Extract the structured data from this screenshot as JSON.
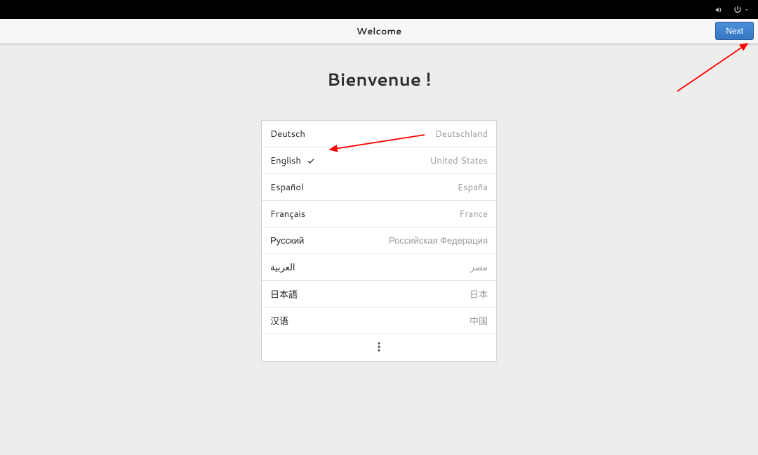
{
  "header": {
    "title": "Welcome",
    "next_label": "Next"
  },
  "welcome": {
    "heading": "Bienvenue !"
  },
  "languages": [
    {
      "name": "Deutsch",
      "country": "Deutschland",
      "selected": false
    },
    {
      "name": "English",
      "country": "United States",
      "selected": true
    },
    {
      "name": "Español",
      "country": "España",
      "selected": false
    },
    {
      "name": "Français",
      "country": "France",
      "selected": false
    },
    {
      "name": "Русский",
      "country": "Российская Федерация",
      "selected": false
    },
    {
      "name": "العربية",
      "country": "مصر",
      "selected": false
    },
    {
      "name": "日本語",
      "country": "日本",
      "selected": false
    },
    {
      "name": "汉语",
      "country": "中国",
      "selected": false
    }
  ],
  "icons": {
    "volume": "volume-icon",
    "power": "power-icon",
    "chevron_down": "chevron-down-icon",
    "check": "check-icon",
    "more": "more-dots-icon"
  }
}
